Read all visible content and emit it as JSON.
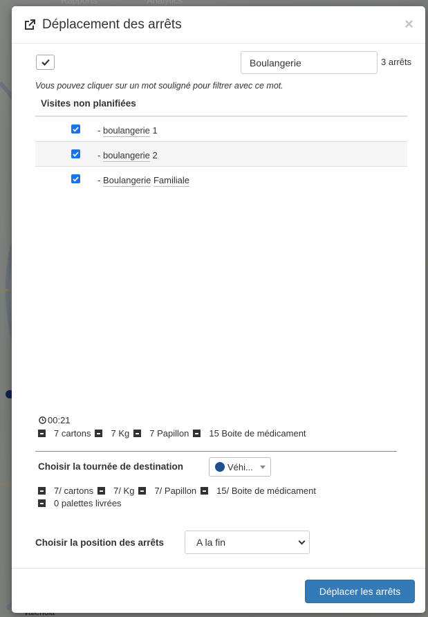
{
  "background": {
    "nav": {
      "rapports_label": "Rapports",
      "analytics_label": "Analytics"
    },
    "map_labels": [
      "Valencia"
    ]
  },
  "modal": {
    "title": "Déplacement des arrêts",
    "close_label": "×",
    "search": {
      "value": "Boulangerie",
      "placeholder": ""
    },
    "count_label": "3 arrêts",
    "hint": "Vous pouvez cliquer sur un mot souligné pour filtrer avec ce mot.",
    "section_title": "Visites non planifiées",
    "stops": [
      {
        "prefix": "-",
        "word1": "boulangerie",
        "word2": "1",
        "word2_underlined": false,
        "checked": true
      },
      {
        "prefix": "-",
        "word1": "boulangerie",
        "word2": "2",
        "word2_underlined": false,
        "checked": true
      },
      {
        "prefix": "-",
        "word1": "Boulangerie",
        "word2": "Familiale",
        "word2_underlined": true,
        "checked": true
      }
    ],
    "summary": {
      "time": "00:21",
      "quantities": [
        "7 cartons",
        "7 Kg",
        "7 Papillon",
        "15 Boite de médicament"
      ]
    },
    "destination": {
      "label": "Choisir la tournée de destination",
      "vehicle_selected": "Véhi...",
      "vehicle_color": "#1f4e8c",
      "quantities": [
        "7/ cartons",
        "7/ Kg",
        "7/ Papillon",
        "15/ Boite de médicament"
      ],
      "palettes": "0 palettes livrées"
    },
    "position": {
      "label": "Choisir la position des arrêts",
      "selected": "A la fin"
    },
    "footer": {
      "move_button": "Déplacer les arrêts"
    }
  },
  "colors": {
    "primary": "#337ab7",
    "checkbox": "#1a73e8"
  }
}
